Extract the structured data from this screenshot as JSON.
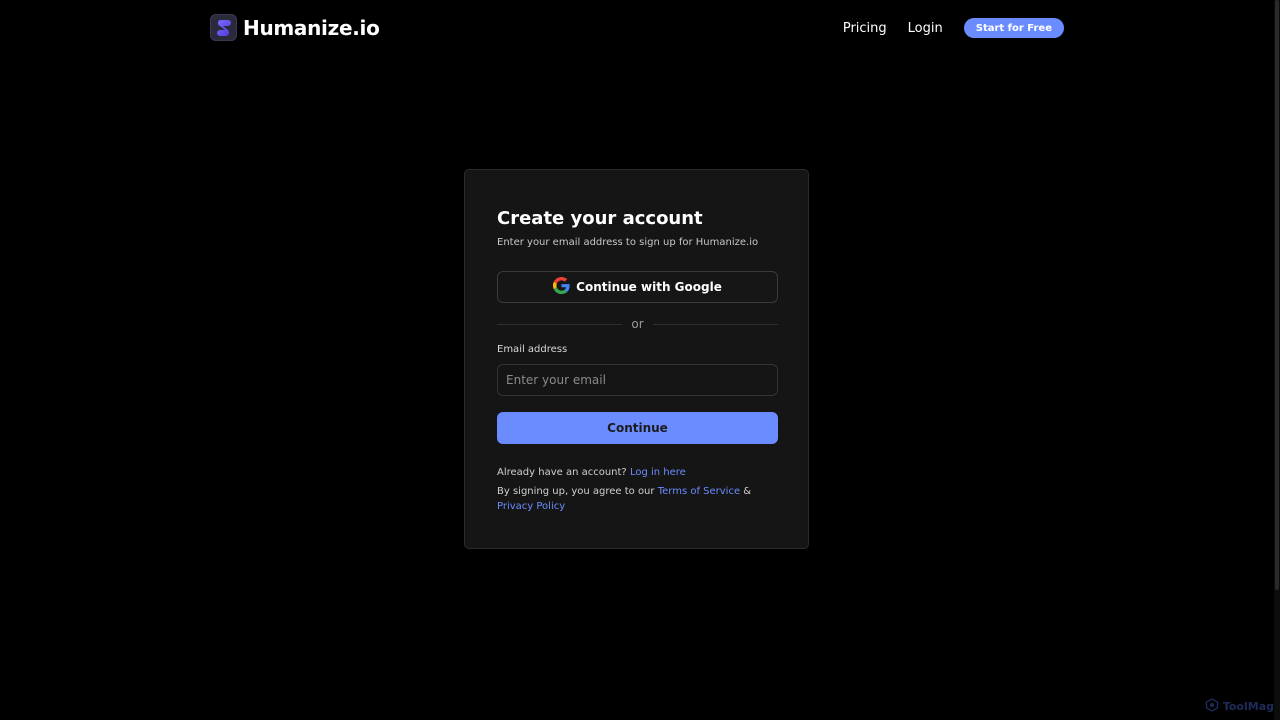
{
  "header": {
    "brand": "Humanize.io",
    "nav": {
      "pricing": "Pricing",
      "login": "Login",
      "cta": "Start for Free"
    }
  },
  "signup": {
    "title": "Create your account",
    "subtitle": "Enter your email address to sign up for Humanize.io",
    "google_label": "Continue with Google",
    "divider": "or",
    "email_label": "Email address",
    "email_placeholder": "Enter your email",
    "email_value": "",
    "continue_label": "Continue",
    "already_text": "Already have an account?",
    "login_link": "Log in here",
    "terms_prefix": "By signing up, you agree to our",
    "terms_link": "Terms of Service",
    "terms_and": "&",
    "privacy_link": "Privacy Policy"
  },
  "watermark": "ToolMag",
  "icons": {
    "brand": "brand-logo-icon",
    "google": "google-icon",
    "watermark": "watermark-logo-icon"
  },
  "colors": {
    "accent": "#6b8cff",
    "background": "#000000",
    "card": "#151515"
  }
}
